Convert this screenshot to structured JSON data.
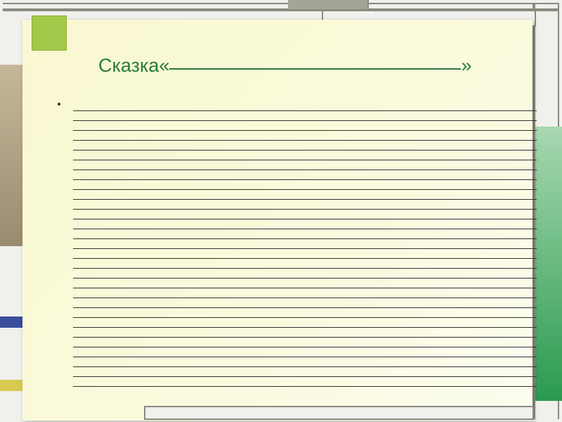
{
  "title": {
    "prefix": "Сказка«",
    "suffix": "»"
  },
  "body": {
    "line_count": 29
  }
}
